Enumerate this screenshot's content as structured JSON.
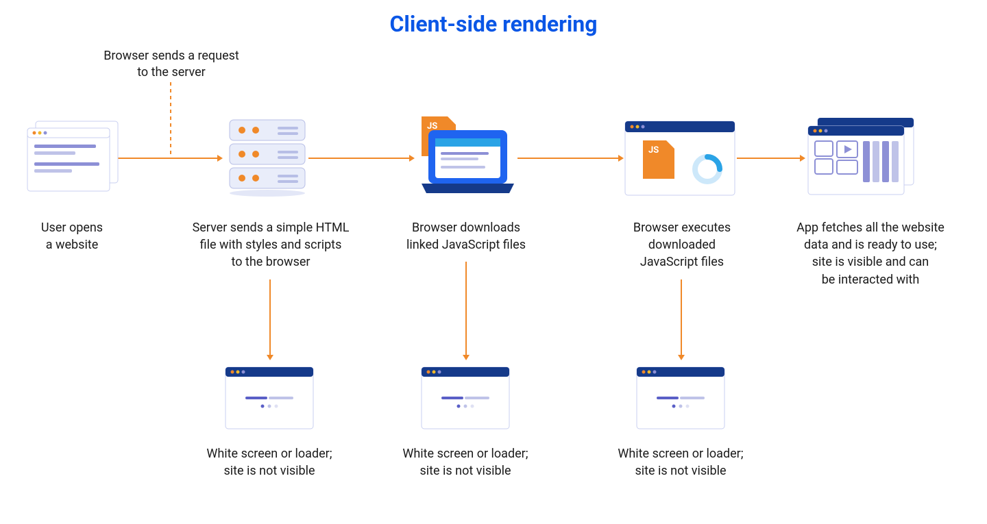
{
  "title": "Client-side rendering",
  "request_note": "Browser sends a request\nto the server",
  "stages": [
    {
      "label": "User opens\na website"
    },
    {
      "label": "Server sends a simple HTML\nfile with styles and scripts\nto the browser"
    },
    {
      "label": "Browser downloads\nlinked JavaScript files"
    },
    {
      "label": "Browser executes\ndownloaded\nJavaScript files"
    },
    {
      "label": "App fetches all the website\ndata and is ready to use;\nsite is visible and can\nbe interacted with"
    }
  ],
  "loading_states": [
    {
      "label": "White screen or loader;\nsite is not visible"
    },
    {
      "label": "White screen or loader;\nsite is not visible"
    },
    {
      "label": "White screen or loader;\nsite is not visible"
    }
  ],
  "icon_badges": {
    "js": "JS"
  },
  "colors": {
    "accent_blue": "#0a56e6",
    "orange": "#f08929",
    "purple": "#8d90d6",
    "navy": "#153a8a",
    "light_blue": "#2aa3e6"
  }
}
